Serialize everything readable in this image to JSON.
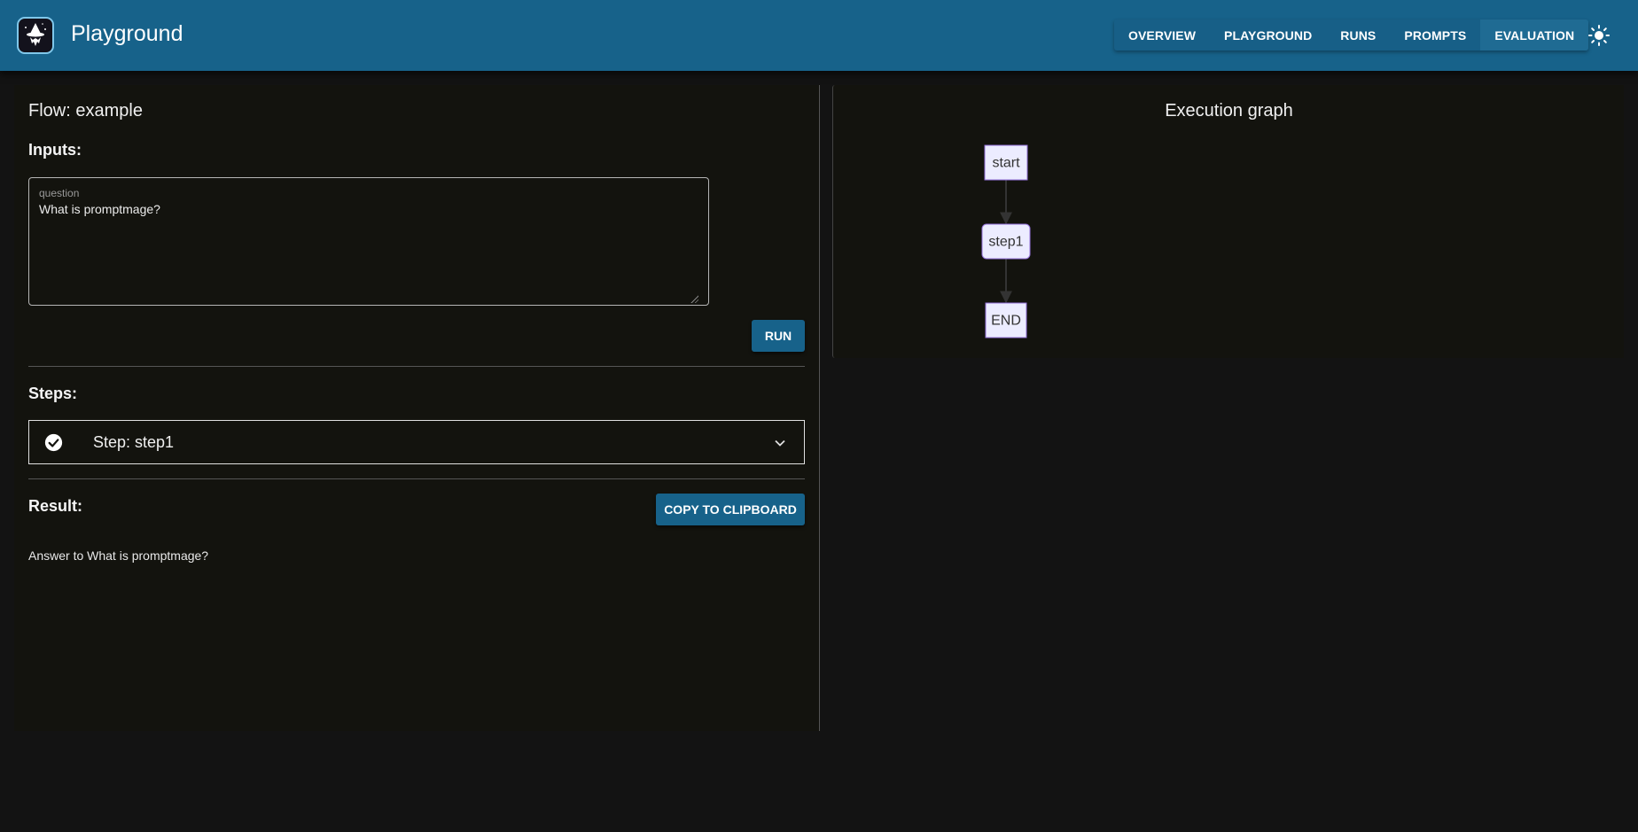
{
  "app": {
    "title": "Playground",
    "logo_icon": "wizard-hat-icon",
    "theme_icon": "sun-icon",
    "brand_color": "#17628a"
  },
  "nav": {
    "items": [
      {
        "label": "OVERVIEW",
        "active": false
      },
      {
        "label": "PLAYGROUND",
        "active": false
      },
      {
        "label": "RUNS",
        "active": false
      },
      {
        "label": "PROMPTS",
        "active": false
      },
      {
        "label": "EVALUATION",
        "active": true
      }
    ]
  },
  "flow": {
    "title": "Flow: example",
    "inputs_label": "Inputs:",
    "input": {
      "label": "question",
      "value": "What is promptmage?"
    },
    "run_label": "RUN",
    "steps_label": "Steps:",
    "steps": [
      {
        "label": "Step: step1",
        "status": "completed",
        "status_icon": "check-circle-icon",
        "expand_icon": "chevron-down-icon"
      }
    ],
    "result_label": "Result:",
    "copy_label": "COPY TO CLIPBOARD",
    "result_text": "Answer to What is promptmage?"
  },
  "graph": {
    "title": "Execution graph",
    "nodes": [
      {
        "id": "start",
        "label": "start",
        "shape": "rect"
      },
      {
        "id": "step1",
        "label": "step1",
        "shape": "rounded"
      },
      {
        "id": "END",
        "label": "END",
        "shape": "rect"
      }
    ],
    "edges": [
      {
        "from": "start",
        "to": "step1"
      },
      {
        "from": "step1",
        "to": "END"
      }
    ],
    "node_fill": "#ececff",
    "node_stroke": "#9370db",
    "edge_color": "#333333"
  }
}
